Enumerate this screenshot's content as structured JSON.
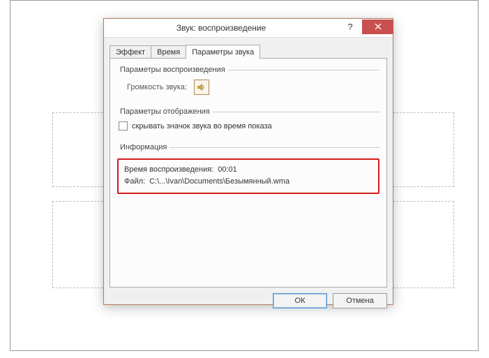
{
  "dialog": {
    "title": "Звук: воспроизведение",
    "tabs": {
      "effect": "Эффект",
      "timing": "Время",
      "sound": "Параметры звука"
    }
  },
  "playback": {
    "legend": "Параметры воспроизведения",
    "volume_label": "Громкость звука:"
  },
  "display": {
    "legend": "Параметры отображения",
    "hide_icon_label": "скрывать значок звука во время показа"
  },
  "info": {
    "legend": "Информация",
    "playtime_label": "Время воспроизведения:",
    "playtime_value": "00:01",
    "file_label": "Файл:",
    "file_value": "C:\\...\\Ivan\\Documents\\Безымянный.wma"
  },
  "buttons": {
    "ok": "ОК",
    "cancel": "Отмена"
  }
}
